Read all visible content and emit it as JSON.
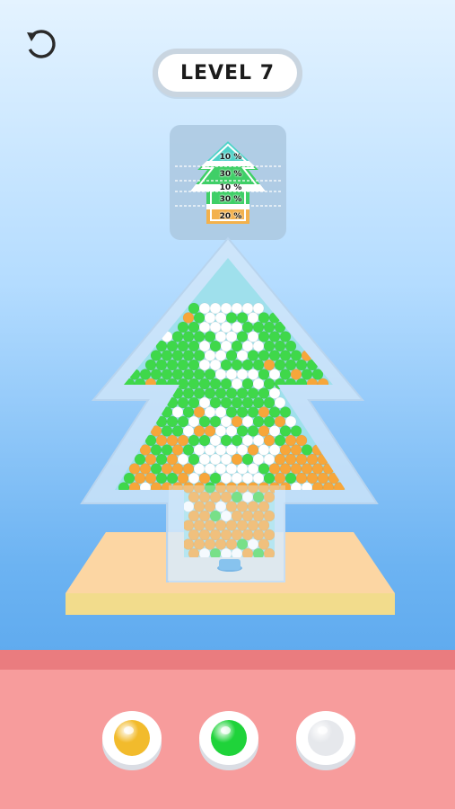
{
  "level": {
    "label": "LEVEL 7"
  },
  "toolbar": {
    "restart_icon": "restart-icon"
  },
  "preview": {
    "bands": [
      {
        "percent": "10 %"
      },
      {
        "percent": "30 %"
      },
      {
        "percent": "10 %"
      },
      {
        "percent": "30 %"
      },
      {
        "percent": "20 %"
      }
    ]
  },
  "color_buttons": [
    {
      "name": "yellow",
      "color": "#f2bb2c"
    },
    {
      "name": "green",
      "color": "#1fd33a"
    },
    {
      "name": "white",
      "color": "#e6e8ec"
    }
  ],
  "colors": {
    "orange_ball": "#f7a63a",
    "green_ball": "#3fd84a",
    "white_ball": "#ffffff",
    "container_glass": "#d2e7f8",
    "container_interior": "#9fe0ec",
    "platform_top": "#fcd6a3",
    "platform_side": "#f2dc8c",
    "bottom_panel": "#f79c9c",
    "bottom_strip": "#ea7c7f"
  }
}
